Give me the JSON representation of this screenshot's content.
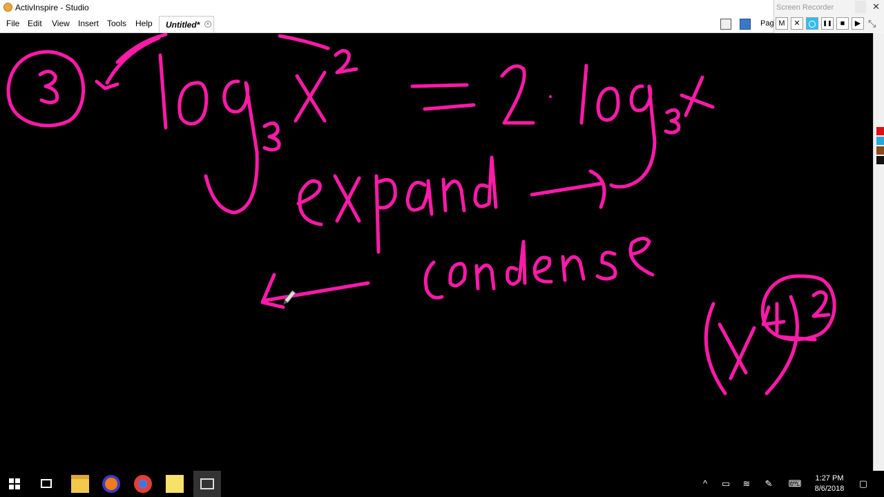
{
  "window": {
    "title": "ActivInspire - Studio"
  },
  "menu": {
    "items": [
      {
        "label": "File"
      },
      {
        "label": "Edit"
      },
      {
        "label": "View"
      },
      {
        "label": "Insert"
      },
      {
        "label": "Tools"
      },
      {
        "label": "Help"
      }
    ],
    "document_tab": "Untitled*",
    "page_label": "Page"
  },
  "recorder": {
    "title": "Screen Recorder",
    "buttons": [
      "M",
      "✕",
      "",
      "❚❚",
      "■",
      "▶"
    ]
  },
  "canvas": {
    "ink_color": "#ff1aa8",
    "background": "#000000"
  },
  "taskbar": {
    "time": "1:27 PM",
    "date": "8/6/2018"
  }
}
